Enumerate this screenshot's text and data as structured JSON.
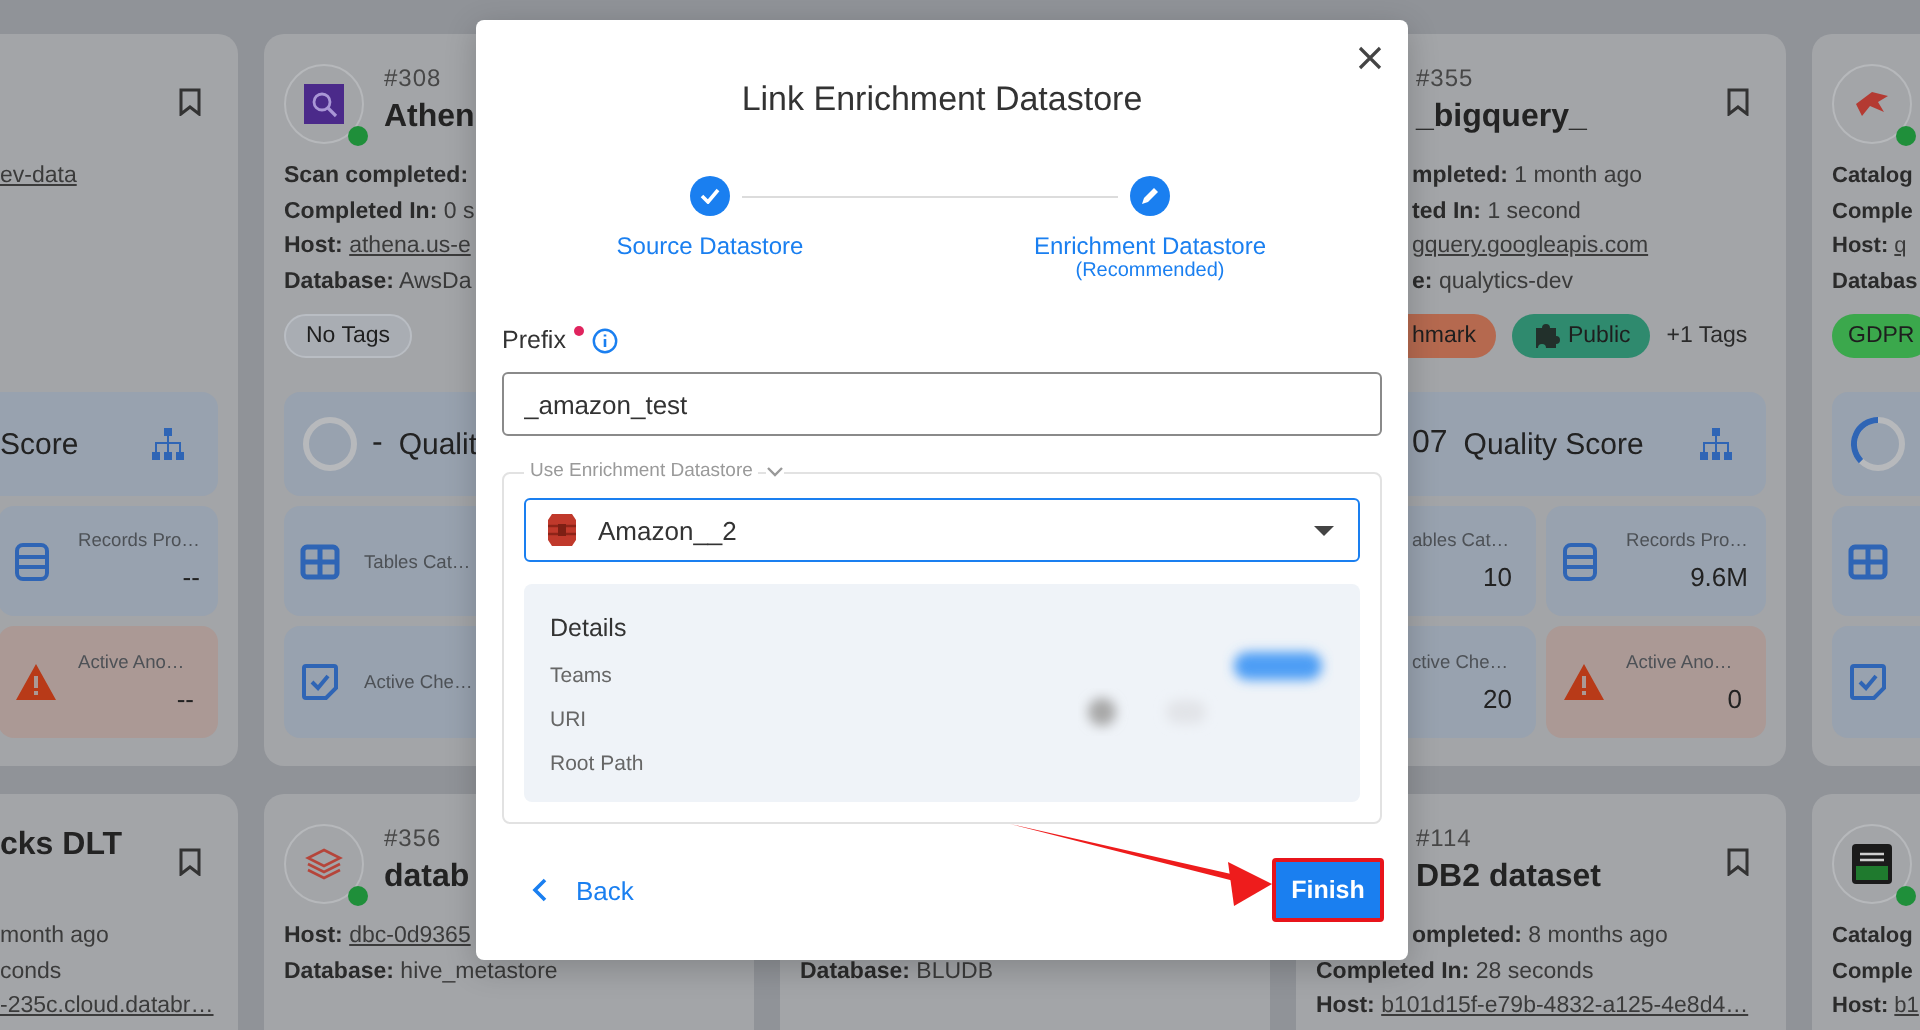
{
  "background": {
    "columns": [
      {
        "cards": [
          {
            "lines": [
              {
                "value": "ev-data",
                "link": true
              }
            ],
            "score": {
              "label": "Score"
            },
            "tiles": [
              {
                "kind": "records",
                "label": "Records Pro…",
                "value": "--"
              },
              {
                "kind": "anomalies",
                "label": "Active Ano…",
                "value": "--"
              }
            ]
          },
          {
            "title": "cks DLT",
            "lines": [
              {
                "value": "month ago",
                "link": false
              },
              {
                "value": "conds",
                "link": false
              },
              {
                "value": "-235c.cloud.databr…",
                "link": true
              }
            ]
          }
        ]
      },
      {
        "cards": [
          {
            "number": "#308",
            "title": "Athen",
            "lines": [
              {
                "label": "Scan completed:"
              },
              {
                "label": "Completed In:",
                "value": "0 s",
                "link": false
              },
              {
                "label": "Host:",
                "value": "athena.us-e",
                "link": true
              },
              {
                "label": "Database:",
                "value": "AwsDa",
                "link": false
              }
            ],
            "tags": [
              {
                "kind": "none",
                "label": "No Tags"
              }
            ],
            "score": {
              "value": "-",
              "label": "Qualit"
            },
            "tiles": [
              {
                "kind": "tables",
                "label": "Tables Cat…"
              },
              {
                "kind": "checks",
                "label": "Active Che…"
              }
            ]
          },
          {
            "number": "#356",
            "title": "datab",
            "lines": [
              {
                "label": "Host:",
                "value": "dbc-0d9365",
                "link": true
              },
              {
                "label": "Database:",
                "value": "hive_metastore",
                "link": false
              }
            ]
          }
        ]
      },
      {
        "cards": [
          {
            "lines": [
              {
                "label": "Database:",
                "value": "BLUDB",
                "link": false
              }
            ]
          }
        ]
      },
      {
        "cards": [
          {
            "number": "#355",
            "title": "_bigquery_",
            "lines": [
              {
                "label": "mpleted:",
                "value": "1 month ago",
                "link": false
              },
              {
                "label": "ted In:",
                "value": "1 second",
                "link": false
              },
              {
                "value": "gquery.googleapis.com",
                "link": true
              },
              {
                "label": "e:",
                "value": "qualytics-dev",
                "link": false
              }
            ],
            "tags": [
              {
                "kind": "tag",
                "label": "hmark",
                "color": "#b5694f"
              },
              {
                "kind": "icon_tag",
                "label": "Public",
                "color": "#2f8a6e"
              },
              {
                "kind": "more",
                "label": "+1 Tags"
              }
            ],
            "score": {
              "value": "07",
              "label": "Quality Score"
            },
            "tiles": [
              {
                "kind": "tables",
                "label": "ables Cat…",
                "value": "10"
              },
              {
                "kind": "records",
                "label": "Records Pro…",
                "value": "9.6M"
              },
              {
                "kind": "checks",
                "label": "ctive Che…",
                "value": "20"
              },
              {
                "kind": "anomalies",
                "label": "Active Ano…",
                "value": "0"
              }
            ]
          },
          {
            "number": "#114",
            "title": "DB2 dataset",
            "lines": [
              {
                "label": "ompleted:",
                "value": "8 months ago",
                "link": false
              },
              {
                "label": "Completed In:",
                "value": "28 seconds",
                "link": false
              },
              {
                "label": "Host:",
                "value": "b101d15f-e79b-4832-a125-4e8d4…",
                "link": true
              }
            ]
          }
        ]
      },
      {
        "cards": [
          {
            "lines": [
              {
                "label": "Catalog"
              },
              {
                "label": "Comple"
              },
              {
                "label": "Host:",
                "value": "q",
                "link": true
              },
              {
                "label": "Databas"
              }
            ],
            "tags": [
              {
                "kind": "tag",
                "label": "GDPR",
                "color": "#3ba84c"
              }
            ],
            "tiles": [
              {
                "kind": "tables"
              },
              {
                "kind": "checks"
              }
            ]
          },
          {
            "lines": [
              {
                "label": "Catalog"
              },
              {
                "label": "Comple"
              },
              {
                "label": "Host:",
                "value": "b1",
                "link": true
              }
            ]
          }
        ]
      }
    ]
  },
  "modal": {
    "title": "Link Enrichment Datastore",
    "steps": [
      {
        "label": "Source Datastore",
        "completed": true
      },
      {
        "label": "Enrichment Datastore",
        "sublabel": "(Recommended)",
        "completed": false
      }
    ],
    "prefix": {
      "label": "Prefix",
      "required": true,
      "value": "_amazon_test"
    },
    "enrichment": {
      "legend": "Use Enrichment Datastore",
      "selected": "Amazon__2",
      "details": {
        "title": "Details",
        "rows": [
          {
            "label": "Teams",
            "redacted": true
          },
          {
            "label": "URI",
            "redacted": true
          },
          {
            "label": "Root Path",
            "redacted": false
          }
        ]
      }
    },
    "back": "Back",
    "finish": {
      "label": "Finish",
      "highlighted": true
    }
  }
}
